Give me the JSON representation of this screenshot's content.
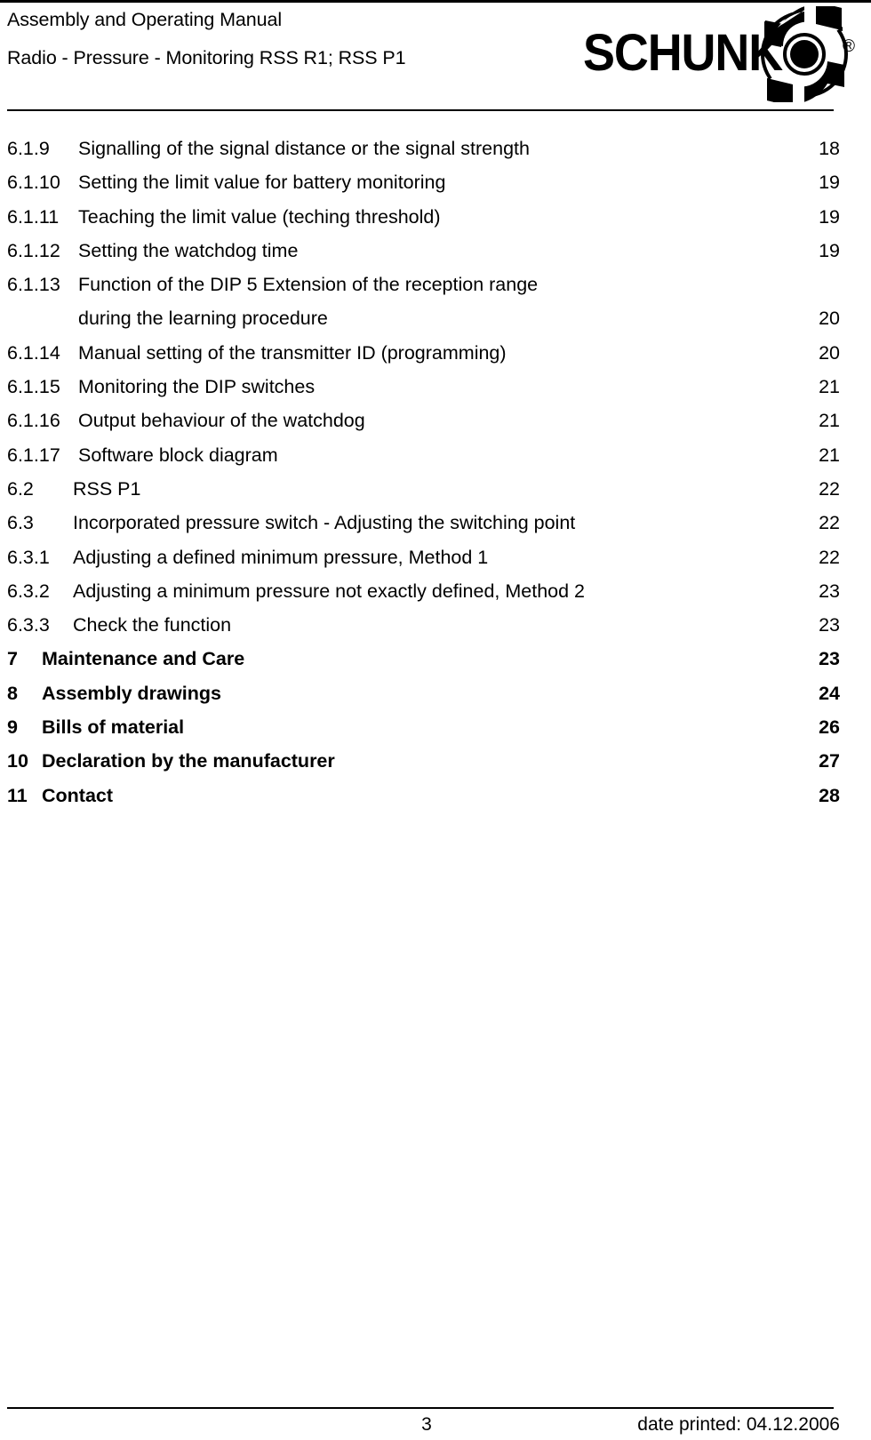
{
  "header": {
    "line1": "Assembly and Operating Manual",
    "line2": "Radio - Pressure - Monitoring RSS R1; RSS P1",
    "logo_word": "SCHUNK",
    "logo_registered": "®"
  },
  "toc": {
    "entries": [
      {
        "number": "6.1.9",
        "title": "Signalling of the signal distance or the signal strength",
        "page": "18",
        "indent": "ind-1",
        "bold": false
      },
      {
        "number": "6.1.10",
        "title": "Setting the limit value for battery monitoring",
        "page": "19",
        "indent": "ind-1",
        "bold": false
      },
      {
        "number": "6.1.11",
        "title": "Teaching the limit value (teching threshold)",
        "page": "19",
        "indent": "ind-1",
        "bold": false
      },
      {
        "number": "6.1.12",
        "title": "Setting the watchdog time",
        "page": "19",
        "indent": "ind-1",
        "bold": false
      },
      {
        "number": "6.1.13",
        "title": "Function of the DIP 5 Extension of the reception range",
        "page": "",
        "indent": "ind-1",
        "bold": false
      },
      {
        "number": "",
        "title": "during the learning procedure",
        "page": "20",
        "indent": "ind-cont",
        "bold": false
      },
      {
        "number": "6.1.14",
        "title": "Manual setting of the transmitter ID (programming)",
        "page": "20",
        "indent": "ind-1",
        "bold": false
      },
      {
        "number": "6.1.15",
        "title": "Monitoring the DIP switches",
        "page": "21",
        "indent": "ind-1",
        "bold": false
      },
      {
        "number": "6.1.16",
        "title": "Output behaviour of the watchdog",
        "page": "21",
        "indent": "ind-1",
        "bold": false
      },
      {
        "number": "6.1.17",
        "title": "Software block diagram",
        "page": "21",
        "indent": "ind-1",
        "bold": false
      },
      {
        "number": "6.2",
        "title": "RSS P1",
        "page": "22",
        "indent": "ind-2",
        "bold": false
      },
      {
        "number": "6.3",
        "title": "Incorporated pressure switch - Adjusting the switching point",
        "page": "22",
        "indent": "ind-2",
        "bold": false
      },
      {
        "number": "6.3.1",
        "title": "Adjusting a defined minimum pressure, Method 1",
        "page": "22",
        "indent": "ind-3",
        "bold": false
      },
      {
        "number": "6.3.2",
        "title": "Adjusting a minimum pressure not exactly defined, Method 2",
        "page": "23",
        "indent": "ind-3",
        "bold": false
      },
      {
        "number": "6.3.3",
        "title": "Check the function",
        "page": "23",
        "indent": "ind-3",
        "bold": false
      },
      {
        "number": "7",
        "title": "Maintenance and Care",
        "page": "23",
        "indent": "ind-4",
        "bold": true
      },
      {
        "number": "8",
        "title": "Assembly drawings",
        "page": "24",
        "indent": "ind-4",
        "bold": true
      },
      {
        "number": "9",
        "title": "Bills of material",
        "page": "26",
        "indent": "ind-4",
        "bold": true
      },
      {
        "number": "10",
        "title": "Declaration by the manufacturer",
        "page": "27",
        "indent": "ind-4",
        "bold": true
      },
      {
        "number": "11",
        "title": "Contact",
        "page": "28",
        "indent": "ind-4",
        "bold": true
      }
    ]
  },
  "footer": {
    "page_number": "3",
    "date_printed": "date printed: 04.12.2006"
  },
  "colors": {
    "text": "#000000",
    "background": "#ffffff",
    "rule": "#000000"
  }
}
